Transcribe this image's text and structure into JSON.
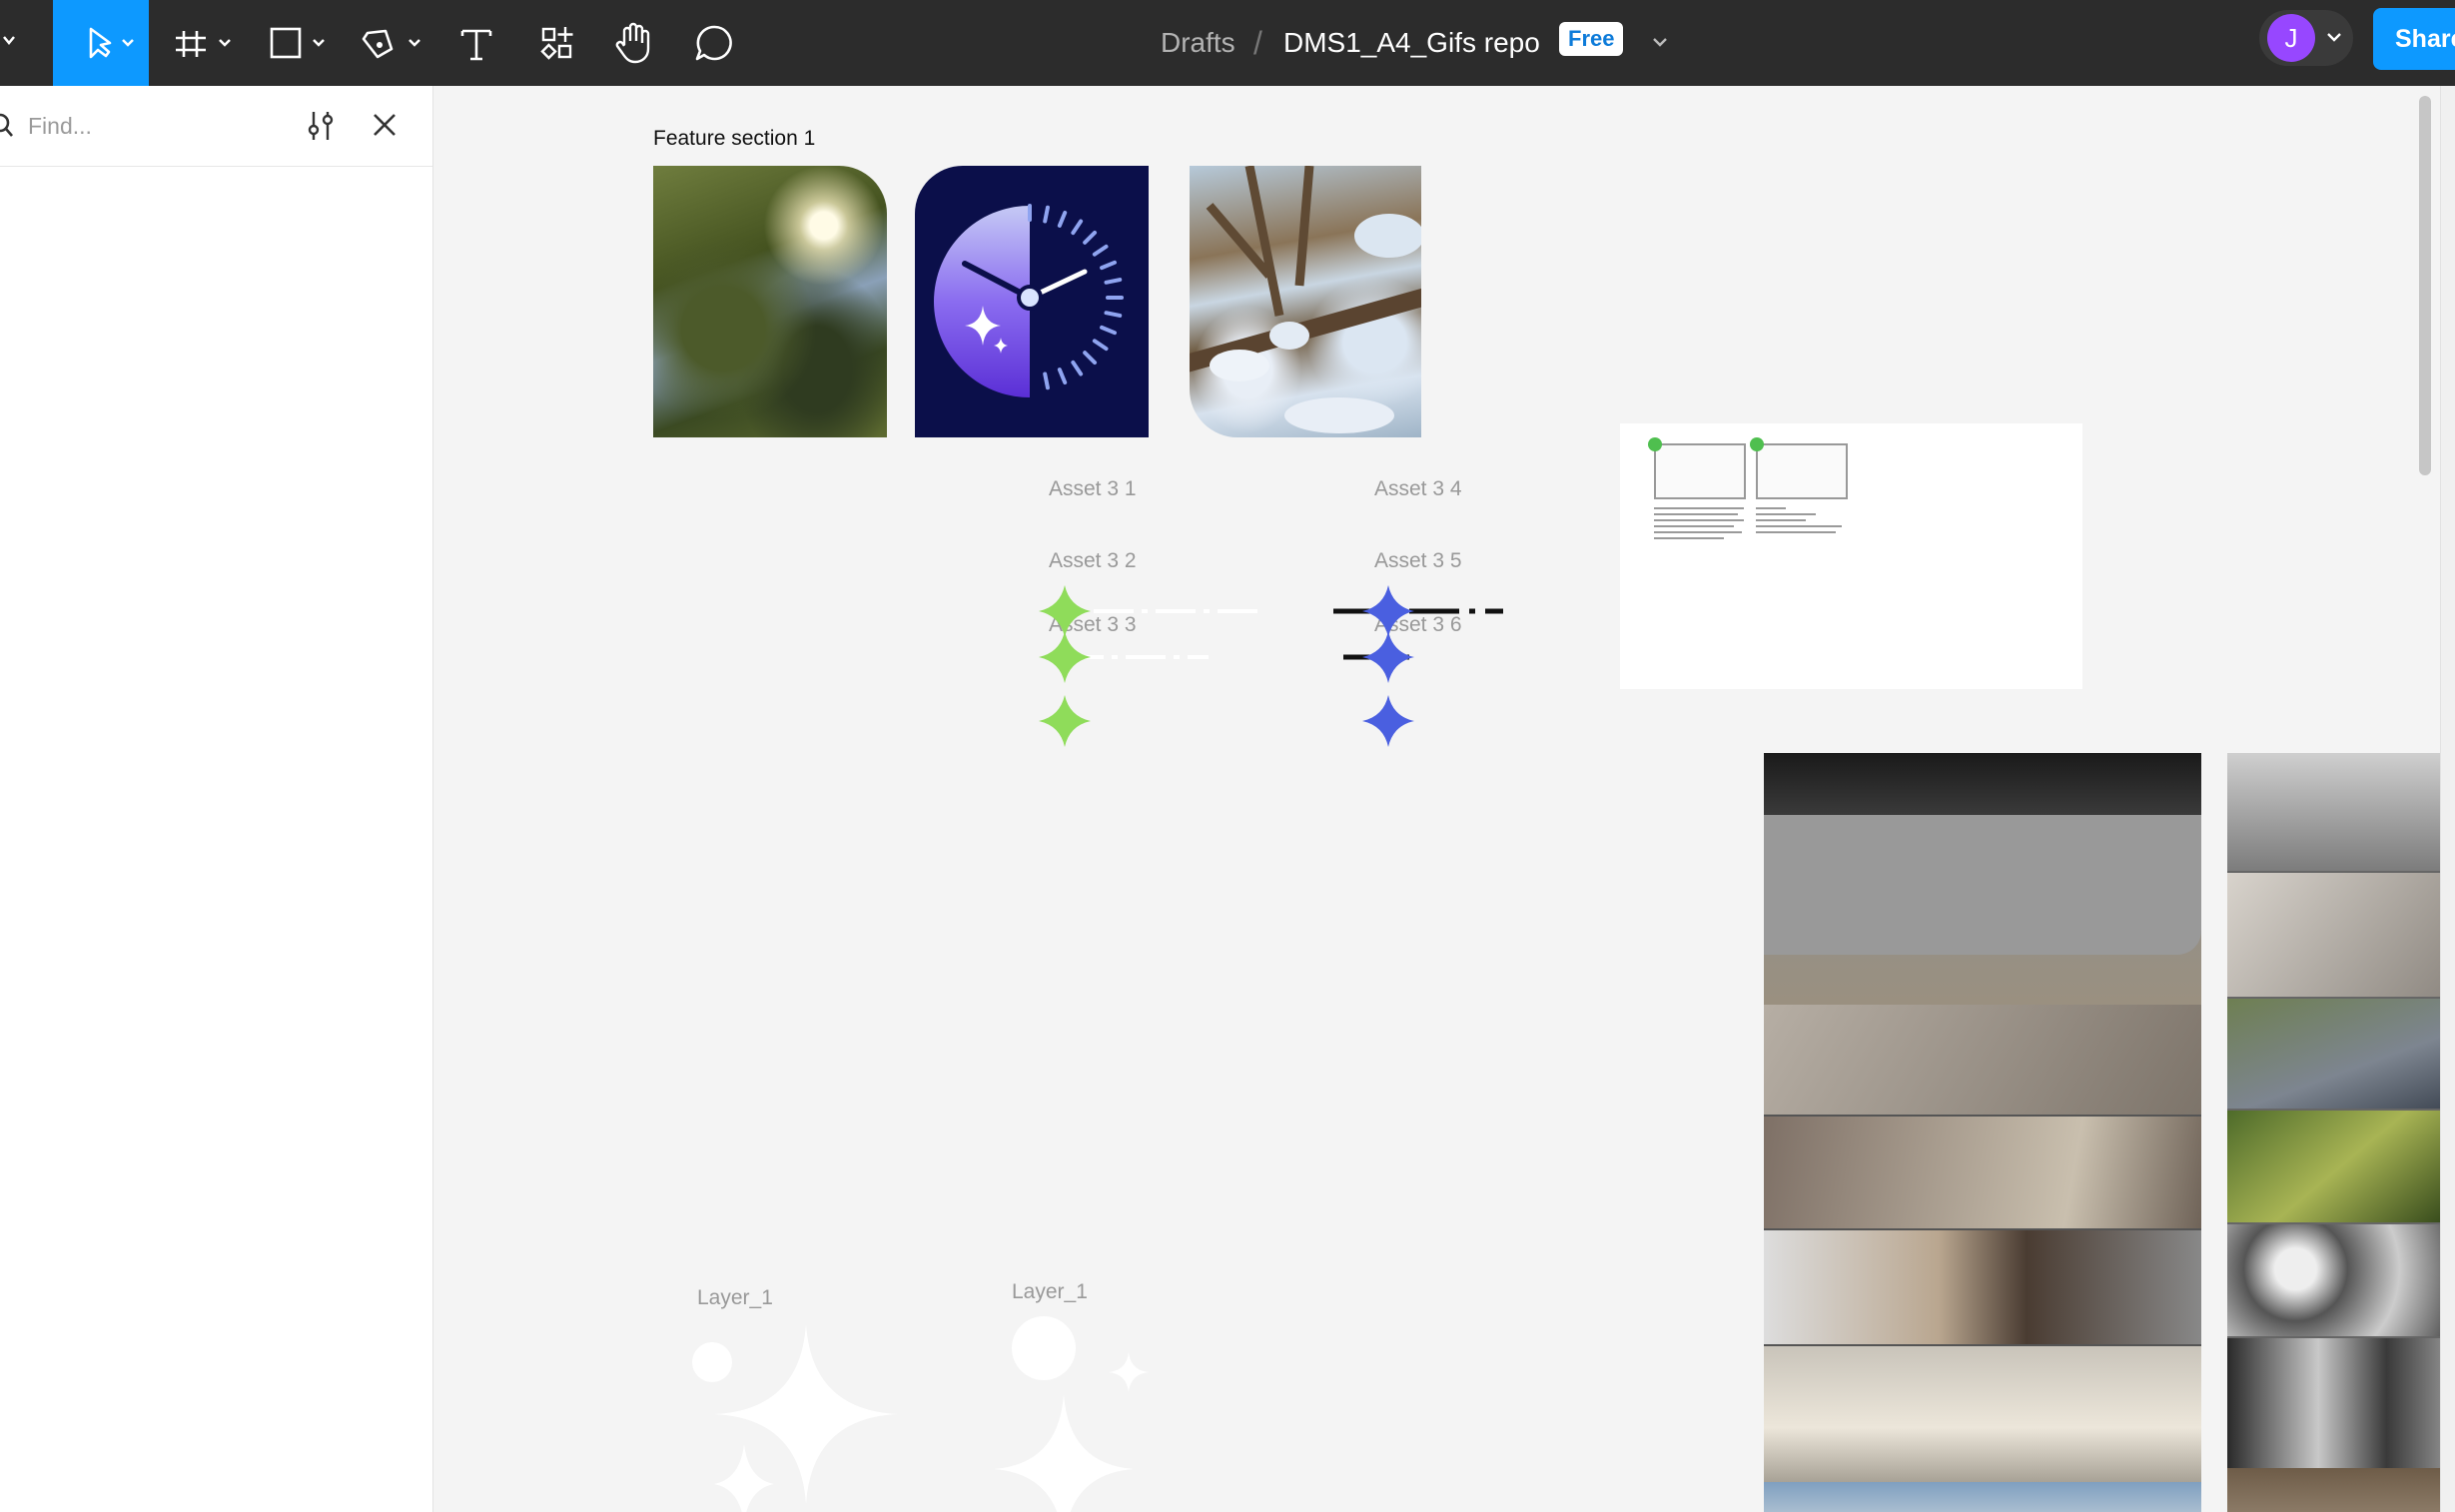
{
  "toolbar": {
    "tools": [
      "main-menu",
      "move",
      "frame",
      "shape",
      "pen",
      "text",
      "resources",
      "hand",
      "comment"
    ],
    "breadcrumb_root": "Drafts",
    "breadcrumb_sep": "/",
    "file_name": "DMS1_A4_Gifs repo",
    "plan_badge": "Free",
    "avatar_initial": "J",
    "share_label": "Share",
    "accent": "#0d99ff"
  },
  "left_panel": {
    "find_placeholder": "Find..."
  },
  "canvas": {
    "feature_section_label": "Feature section 1",
    "assets_left": [
      "Asset 3 1",
      "Asset 3 2",
      "Asset 3 3"
    ],
    "assets_right": [
      "Asset 3 4",
      "Asset 3 5",
      "Asset 3 6"
    ],
    "layer_labels": [
      "Layer_1",
      "Layer_1"
    ],
    "green_star_color": "#8fdc5a",
    "blue_star_color": "#4a5fe0"
  }
}
